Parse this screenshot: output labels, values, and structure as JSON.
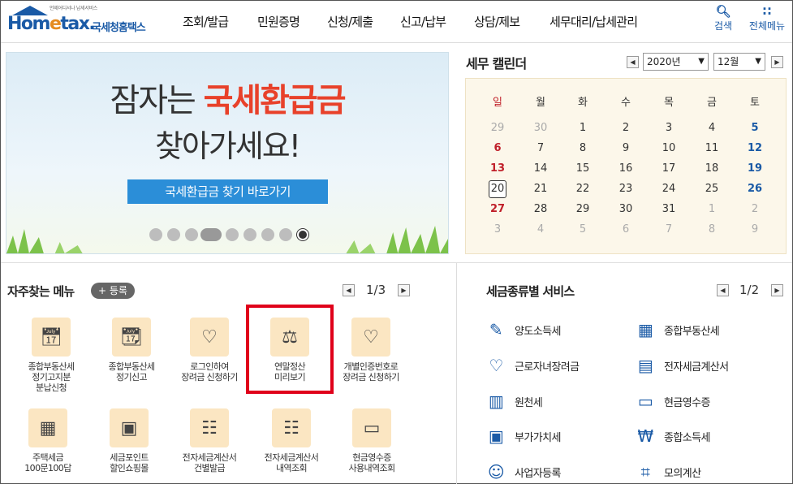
{
  "header": {
    "tagline": "언제어디서나 납세서비스",
    "logo_home": "Hom",
    "logo_e": "e",
    "logo_tax": "tax.",
    "logo_kr": "국세청홈택스",
    "nav": [
      "조회/발급",
      "민원증명",
      "신청/제출",
      "신고/납부",
      "상담/제보",
      "세무대리/납세관리"
    ],
    "search_label": "검색",
    "menu_label": "전체메뉴"
  },
  "banner": {
    "line1_a": "잠자는 ",
    "line1_b": "국세환급금",
    "line2": "찾아가세요!",
    "button": "국세환급금 찾기 바로가기"
  },
  "calendar": {
    "title": "세무 캘린더",
    "year": "2020년",
    "month": "12월",
    "weekdays": [
      "일",
      "월",
      "화",
      "수",
      "목",
      "금",
      "토"
    ],
    "weeks": [
      [
        "29",
        "30",
        "1",
        "2",
        "3",
        "4",
        "5"
      ],
      [
        "6",
        "7",
        "8",
        "9",
        "10",
        "11",
        "12"
      ],
      [
        "13",
        "14",
        "15",
        "16",
        "17",
        "18",
        "19"
      ],
      [
        "20",
        "21",
        "22",
        "23",
        "24",
        "25",
        "26"
      ],
      [
        "27",
        "28",
        "29",
        "30",
        "31",
        "1",
        "2"
      ],
      [
        "3",
        "4",
        "5",
        "6",
        "7",
        "8",
        "9"
      ]
    ]
  },
  "favorites": {
    "title": "자주찾는 메뉴",
    "register": "+ 등록",
    "page": "1/3",
    "items": [
      {
        "label": "종합부동산세\n정기고지분\n분납신청",
        "icon": "calendar-check-icon"
      },
      {
        "label": "종합부동산세\n정기신고",
        "icon": "calendar-edit-icon"
      },
      {
        "label": "로그인하여\n장려금 신청하기",
        "icon": "heart-pen-icon"
      },
      {
        "label": "연말정산\n미리보기",
        "icon": "money-bag-icon"
      },
      {
        "label": "개별인증번호로\n장려금 신청하기",
        "icon": "heart-hourglass-icon"
      },
      {
        "label": "주택세금\n100문100답",
        "icon": "building-icon"
      },
      {
        "label": "세금포인트\n할인쇼핑몰",
        "icon": "shopping-bag-icon"
      },
      {
        "label": "전자세금계산서\n건별발급",
        "icon": "invoice-icon"
      },
      {
        "label": "전자세금계산서\n내역조회",
        "icon": "invoice-search-icon"
      },
      {
        "label": "현금영수증\n사용내역조회",
        "icon": "receipt-search-icon"
      }
    ]
  },
  "services": {
    "title": "세금종류별 서비스",
    "page": "1/2",
    "items": [
      {
        "label": "양도소득세",
        "icon": "document-pen-icon"
      },
      {
        "label": "종합부동산세",
        "icon": "buildings-icon"
      },
      {
        "label": "근로자녀장려금",
        "icon": "heart-hands-icon"
      },
      {
        "label": "전자세금계산서",
        "icon": "calculator-doc-icon"
      },
      {
        "label": "원천세",
        "icon": "ledger-icon"
      },
      {
        "label": "현금영수증",
        "icon": "receipt-1000-icon"
      },
      {
        "label": "부가가치세",
        "icon": "vat-icon"
      },
      {
        "label": "종합소득세",
        "icon": "won-bag-icon"
      },
      {
        "label": "사업자등록",
        "icon": "person-icon"
      },
      {
        "label": "모의계산",
        "icon": "calculator-icon"
      }
    ]
  },
  "colors": {
    "brand": "#1a5aa6",
    "accent_red": "#e8412a",
    "highlight": "#e0001a"
  }
}
